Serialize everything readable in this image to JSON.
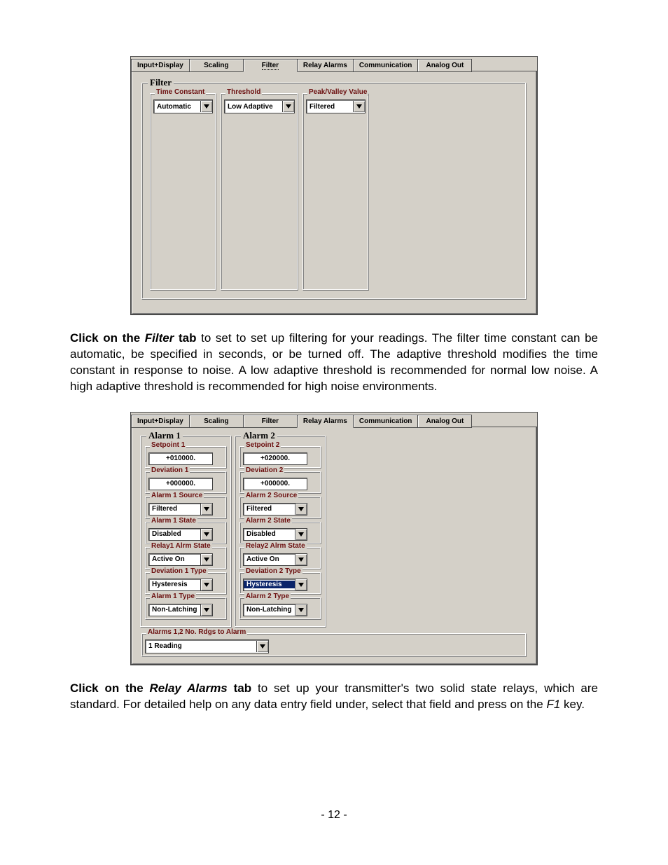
{
  "tabs": {
    "input_display": "Input+Display",
    "scaling": "Scaling",
    "filter": "Filter",
    "relay_alarms": "Relay Alarms",
    "communication": "Communication",
    "analog_out": "Analog Out"
  },
  "shot1": {
    "group_title": "Filter",
    "time_constant": {
      "label": "Time Constant",
      "value": "Automatic"
    },
    "threshold": {
      "label": "Threshold",
      "value": "Low Adaptive"
    },
    "peak_valley": {
      "label": "Peak/Valley Value",
      "value": "Filtered"
    }
  },
  "para1": {
    "lead": "Click on the ",
    "em": "Filter",
    "lead2": " tab",
    "rest": " to set to set up filtering for your readings. The filter time constant can be automatic, be specified in seconds, or be turned off. The adaptive threshold modifies the time constant in response to noise. A low adaptive threshold is recommended for normal low noise. A high adaptive threshold is recommended for high noise environments."
  },
  "shot2": {
    "alarm1": {
      "title": "Alarm 1",
      "setpoint": {
        "label": "Setpoint 1",
        "value": "+010000."
      },
      "deviation": {
        "label": "Deviation 1",
        "value": "+000000."
      },
      "source": {
        "label": "Alarm 1 Source",
        "value": "Filtered"
      },
      "state": {
        "label": "Alarm 1 State",
        "value": "Disabled"
      },
      "relay_state": {
        "label": "Relay1 Alrm State",
        "value": "Active On"
      },
      "dev_type": {
        "label": "Deviation 1 Type",
        "value": "Hysteresis"
      },
      "type": {
        "label": "Alarm 1 Type",
        "value": "Non-Latching"
      }
    },
    "alarm2": {
      "title": "Alarm 2",
      "setpoint": {
        "label": "Setpoint 2",
        "value": "+020000."
      },
      "deviation": {
        "label": "Deviation 2",
        "value": "+000000."
      },
      "source": {
        "label": "Alarm 2 Source",
        "value": "Filtered"
      },
      "state": {
        "label": "Alarm 2 State",
        "value": "Disabled"
      },
      "relay_state": {
        "label": "Relay2 Alrm State",
        "value": "Active On"
      },
      "dev_type": {
        "label": "Deviation 2 Type",
        "value": "Hysteresis"
      },
      "type": {
        "label": "Alarm 2 Type",
        "value": "Non-Latching"
      }
    },
    "rdgs": {
      "label": "Alarms 1,2  No. Rdgs to Alarm",
      "value": "1 Reading"
    }
  },
  "para2": {
    "lead": "Click on the ",
    "em": "Relay Alarms",
    "lead2": " tab",
    "rest_a": " to set up your transmitter's two solid state relays, which are standard. For detailed help on any data entry field under, select that field and press on the ",
    "f1": "F1",
    "rest_b": " key."
  },
  "page_number": "- 12 -"
}
